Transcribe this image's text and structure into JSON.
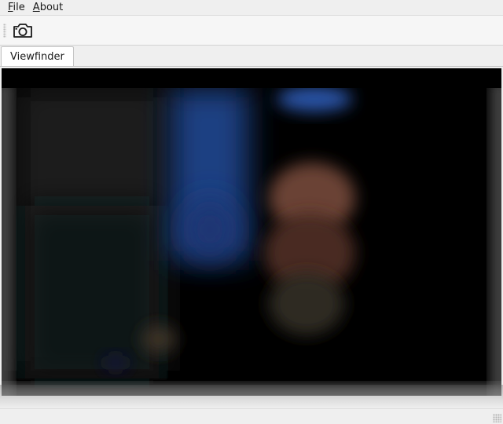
{
  "menubar": {
    "items": [
      {
        "mnemonic": "F",
        "rest": "ile"
      },
      {
        "mnemonic": "A",
        "rest": "bout"
      }
    ]
  },
  "toolbar": {
    "capture_icon": "camera-icon"
  },
  "tabs": [
    {
      "label": "Viewfinder",
      "active": true
    }
  ],
  "colors": {
    "window_bg": "#efefef",
    "viewfinder_bg": "#000000"
  }
}
